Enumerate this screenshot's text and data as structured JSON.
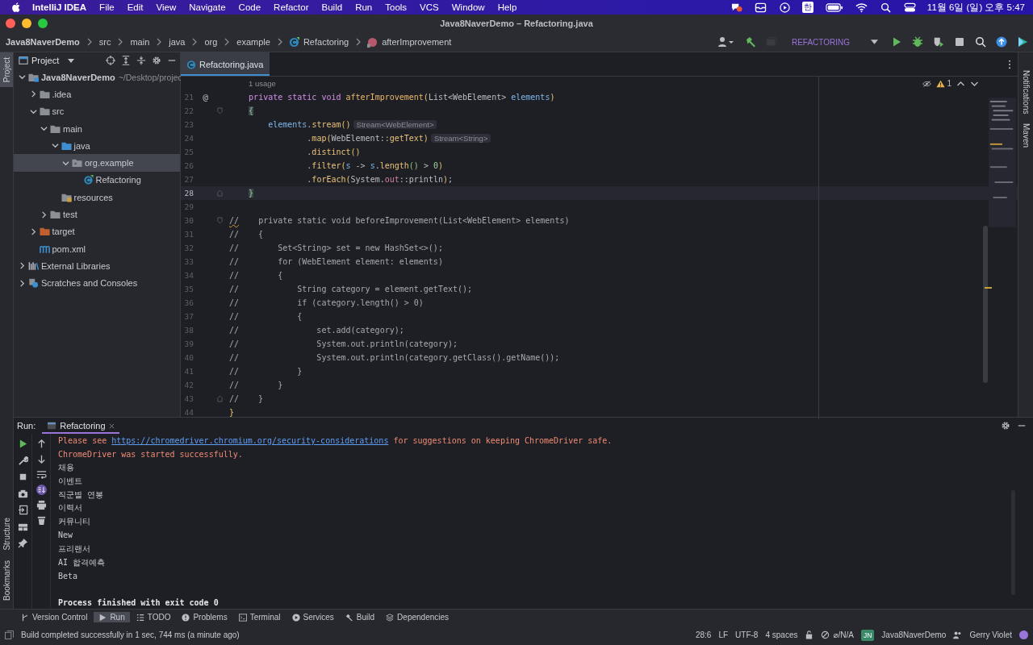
{
  "menubar": {
    "app": "IntelliJ IDEA",
    "menus": [
      "File",
      "Edit",
      "View",
      "Navigate",
      "Code",
      "Refactor",
      "Build",
      "Run",
      "Tools",
      "VCS",
      "Window",
      "Help"
    ],
    "input_method": "한",
    "clock": "11월 6일 (일) 오후 5:47"
  },
  "window": {
    "title": "Java8NaverDemo – Refactoring.java"
  },
  "breadcrumbs": [
    {
      "label": "Java8NaverDemo",
      "kind": "project"
    },
    {
      "label": "src",
      "kind": "folder"
    },
    {
      "label": "main",
      "kind": "folder"
    },
    {
      "label": "java",
      "kind": "folder"
    },
    {
      "label": "org",
      "kind": "folder"
    },
    {
      "label": "example",
      "kind": "folder"
    },
    {
      "label": "Refactoring",
      "kind": "class"
    },
    {
      "label": "afterImprovement",
      "kind": "method"
    }
  ],
  "run_config": "REFACTORING",
  "left_stripe_top": [
    {
      "label": "Project",
      "selected": true
    }
  ],
  "left_stripe_bottom": [
    {
      "label": "Structure",
      "selected": false
    },
    {
      "label": "Bookmarks",
      "selected": false
    }
  ],
  "right_stripe": [
    "Notifications",
    "Maven"
  ],
  "project_panel": {
    "title": "Project",
    "tree": [
      {
        "label": "Java8NaverDemo",
        "kind": "module",
        "hint": "~/Desktop/projec",
        "expanded": true,
        "selected": false,
        "children": [
          {
            "label": ".idea",
            "kind": "folder",
            "expanded": false,
            "selected": false
          },
          {
            "label": "src",
            "kind": "folder",
            "expanded": true,
            "selected": false,
            "children": [
              {
                "label": "main",
                "kind": "folder",
                "expanded": true,
                "selected": false,
                "children": [
                  {
                    "label": "java",
                    "kind": "source",
                    "expanded": true,
                    "selected": false,
                    "children": [
                      {
                        "label": "org.example",
                        "kind": "package",
                        "expanded": true,
                        "selected": true,
                        "children": [
                          {
                            "label": "Refactoring",
                            "kind": "class",
                            "selected": false
                          }
                        ]
                      }
                    ]
                  },
                  {
                    "label": "resources",
                    "kind": "resources",
                    "selected": false
                  }
                ]
              },
              {
                "label": "test",
                "kind": "folder",
                "expanded": false,
                "selected": false
              }
            ]
          },
          {
            "label": "target",
            "kind": "target",
            "expanded": false,
            "selected": false
          },
          {
            "label": "pom.xml",
            "kind": "maven",
            "selected": false
          }
        ]
      },
      {
        "label": "External Libraries",
        "kind": "libraries",
        "expanded": false,
        "selected": false
      },
      {
        "label": "Scratches and Consoles",
        "kind": "scratches",
        "expanded": false,
        "selected": false
      }
    ]
  },
  "editor": {
    "tabs": [
      {
        "label": "Refactoring.java",
        "selected": true
      }
    ],
    "usage_hint": "1 usage",
    "warning_count": "1",
    "lines": [
      {
        "number": "21",
        "gutter": "@",
        "current": false,
        "tokens": [
          {
            "kind": "keyword",
            "text": "    private static void "
          },
          {
            "kind": "method",
            "text": "afterImprovement"
          },
          {
            "kind": "bracket-yellow",
            "text": "("
          },
          {
            "kind": "plain",
            "text": "List<WebElement> "
          },
          {
            "kind": "param",
            "text": "elements"
          },
          {
            "kind": "bracket-yellow",
            "text": ")"
          }
        ]
      },
      {
        "number": "22",
        "fold_start": true,
        "current": false,
        "tokens": [
          {
            "kind": "brace-match",
            "text": "    {"
          }
        ]
      },
      {
        "number": "23",
        "current": false,
        "tokens": [
          {
            "kind": "param",
            "text": "        elements"
          },
          {
            "kind": "plain",
            "text": "."
          },
          {
            "kind": "call",
            "text": "stream"
          },
          {
            "kind": "bracket-yellow",
            "text": "()"
          },
          {
            "kind": "hint",
            "text": "Stream<WebElement>"
          }
        ]
      },
      {
        "number": "24",
        "current": false,
        "tokens": [
          {
            "kind": "plain",
            "text": "                ."
          },
          {
            "kind": "call",
            "text": "map"
          },
          {
            "kind": "bracket-yellow",
            "text": "("
          },
          {
            "kind": "plain",
            "text": "WebElement::"
          },
          {
            "kind": "call",
            "text": "getText"
          },
          {
            "kind": "bracket-yellow",
            "text": ")"
          },
          {
            "kind": "hint",
            "text": "Stream<String>"
          }
        ]
      },
      {
        "number": "25",
        "current": false,
        "tokens": [
          {
            "kind": "plain",
            "text": "                ."
          },
          {
            "kind": "call",
            "text": "distinct"
          },
          {
            "kind": "bracket-yellow",
            "text": "()"
          }
        ]
      },
      {
        "number": "26",
        "current": false,
        "tokens": [
          {
            "kind": "plain",
            "text": "                ."
          },
          {
            "kind": "call",
            "text": "filter"
          },
          {
            "kind": "bracket-yellow",
            "text": "("
          },
          {
            "kind": "param",
            "text": "s"
          },
          {
            "kind": "plain",
            "text": " -> "
          },
          {
            "kind": "param",
            "text": "s"
          },
          {
            "kind": "plain",
            "text": "."
          },
          {
            "kind": "call",
            "text": "length"
          },
          {
            "kind": "bracket-green",
            "text": "()"
          },
          {
            "kind": "plain",
            "text": " > "
          },
          {
            "kind": "number",
            "text": "0"
          },
          {
            "kind": "bracket-yellow",
            "text": ")"
          }
        ]
      },
      {
        "number": "27",
        "current": false,
        "tokens": [
          {
            "kind": "plain",
            "text": "                ."
          },
          {
            "kind": "call",
            "text": "forEach"
          },
          {
            "kind": "bracket-yellow",
            "text": "("
          },
          {
            "kind": "plain",
            "text": "System."
          },
          {
            "kind": "field",
            "text": "out"
          },
          {
            "kind": "plain",
            "text": "::println"
          },
          {
            "kind": "bracket-yellow",
            "text": ")"
          },
          {
            "kind": "plain",
            "text": ";"
          }
        ]
      },
      {
        "number": "28",
        "fold_end": true,
        "current": true,
        "tokens": [
          {
            "kind": "brace-match",
            "text": "    }"
          }
        ]
      },
      {
        "number": "29",
        "current": false
      },
      {
        "number": "30",
        "fold_start": true,
        "current": false,
        "tokens": [
          {
            "kind": "comment-typo",
            "text": "//"
          },
          {
            "kind": "comment",
            "text": "    private static void beforeImprovement(List<WebElement> elements)"
          }
        ]
      },
      {
        "number": "31",
        "current": false,
        "tokens": [
          {
            "kind": "comment",
            "text": "//    {"
          }
        ]
      },
      {
        "number": "32",
        "current": false,
        "tokens": [
          {
            "kind": "comment",
            "text": "//        Set<String> set = new HashSet<>();"
          }
        ]
      },
      {
        "number": "33",
        "current": false,
        "tokens": [
          {
            "kind": "comment",
            "text": "//        for (WebElement element: elements)"
          }
        ]
      },
      {
        "number": "34",
        "current": false,
        "tokens": [
          {
            "kind": "comment",
            "text": "//        {"
          }
        ]
      },
      {
        "number": "35",
        "current": false,
        "tokens": [
          {
            "kind": "comment",
            "text": "//            String category = element.getText();"
          }
        ]
      },
      {
        "number": "36",
        "current": false,
        "tokens": [
          {
            "kind": "comment",
            "text": "//            if (category.length() > 0)"
          }
        ]
      },
      {
        "number": "37",
        "current": false,
        "tokens": [
          {
            "kind": "comment",
            "text": "//            {"
          }
        ]
      },
      {
        "number": "38",
        "current": false,
        "tokens": [
          {
            "kind": "comment",
            "text": "//                set.add(category);"
          }
        ]
      },
      {
        "number": "39",
        "current": false,
        "tokens": [
          {
            "kind": "comment",
            "text": "//                System.out.println(category);"
          }
        ]
      },
      {
        "number": "40",
        "current": false,
        "tokens": [
          {
            "kind": "comment",
            "text": "//                System.out.println(category.getClass().getName());"
          }
        ]
      },
      {
        "number": "41",
        "current": false,
        "tokens": [
          {
            "kind": "comment",
            "text": "//            }"
          }
        ]
      },
      {
        "number": "42",
        "current": false,
        "tokens": [
          {
            "kind": "comment",
            "text": "//        }"
          }
        ]
      },
      {
        "number": "43",
        "fold_end": true,
        "current": false,
        "tokens": [
          {
            "kind": "comment",
            "text": "//    }"
          }
        ]
      },
      {
        "number": "44",
        "current": false,
        "tokens": [
          {
            "kind": "bracket-yellow",
            "text": "}"
          }
        ]
      }
    ]
  },
  "run_panel": {
    "label": "Run:",
    "tabs": [
      {
        "label": "Refactoring",
        "selected": true
      }
    ],
    "output": [
      {
        "tokens": [
          {
            "kind": "stderr",
            "text": "Please see "
          },
          {
            "kind": "link",
            "text": "https://chromedriver.chromium.org/security-considerations"
          },
          {
            "kind": "stderr",
            "text": " for suggestions on keeping ChromeDriver safe."
          }
        ]
      },
      {
        "tokens": [
          {
            "kind": "stderr",
            "text": "ChromeDriver was started successfully."
          }
        ]
      },
      {
        "tokens": [
          {
            "kind": "stdout",
            "text": "채용"
          }
        ]
      },
      {
        "tokens": [
          {
            "kind": "stdout",
            "text": "이벤트"
          }
        ]
      },
      {
        "tokens": [
          {
            "kind": "stdout",
            "text": "직군별 연봉"
          }
        ]
      },
      {
        "tokens": [
          {
            "kind": "stdout",
            "text": "이력서"
          }
        ]
      },
      {
        "tokens": [
          {
            "kind": "stdout",
            "text": "커뮤니티"
          }
        ]
      },
      {
        "tokens": [
          {
            "kind": "stdout",
            "text": "New"
          }
        ]
      },
      {
        "tokens": [
          {
            "kind": "stdout",
            "text": "프리랜서"
          }
        ]
      },
      {
        "tokens": [
          {
            "kind": "stdout",
            "text": "AI 합격예측"
          }
        ]
      },
      {
        "tokens": [
          {
            "kind": "stdout",
            "text": "Beta"
          }
        ]
      },
      {
        "tokens": [
          {
            "kind": "system",
            "text": "Process finished with exit code 0"
          }
        ]
      }
    ]
  },
  "tool_windows": [
    {
      "label": "Version Control",
      "kind": "vcs",
      "selected": false
    },
    {
      "label": "Run",
      "kind": "run",
      "selected": true
    },
    {
      "label": "TODO",
      "kind": "todo",
      "selected": false
    },
    {
      "label": "Problems",
      "kind": "problems",
      "selected": false
    },
    {
      "label": "Terminal",
      "kind": "terminal",
      "selected": false
    },
    {
      "label": "Services",
      "kind": "services",
      "selected": false
    },
    {
      "label": "Build",
      "kind": "build",
      "selected": false
    },
    {
      "label": "Dependencies",
      "kind": "dependencies",
      "selected": false
    }
  ],
  "status_bar": {
    "message": "Build completed successfully in 1 sec, 744 ms (a minute ago)",
    "position": "28:6",
    "line_separator": "LF",
    "encoding": "UTF-8",
    "indent": "4 spaces",
    "vcs": "⌀/N/A",
    "project_badge": "JN",
    "project": "Java8NaverDemo",
    "user": "Gerry Violet"
  }
}
